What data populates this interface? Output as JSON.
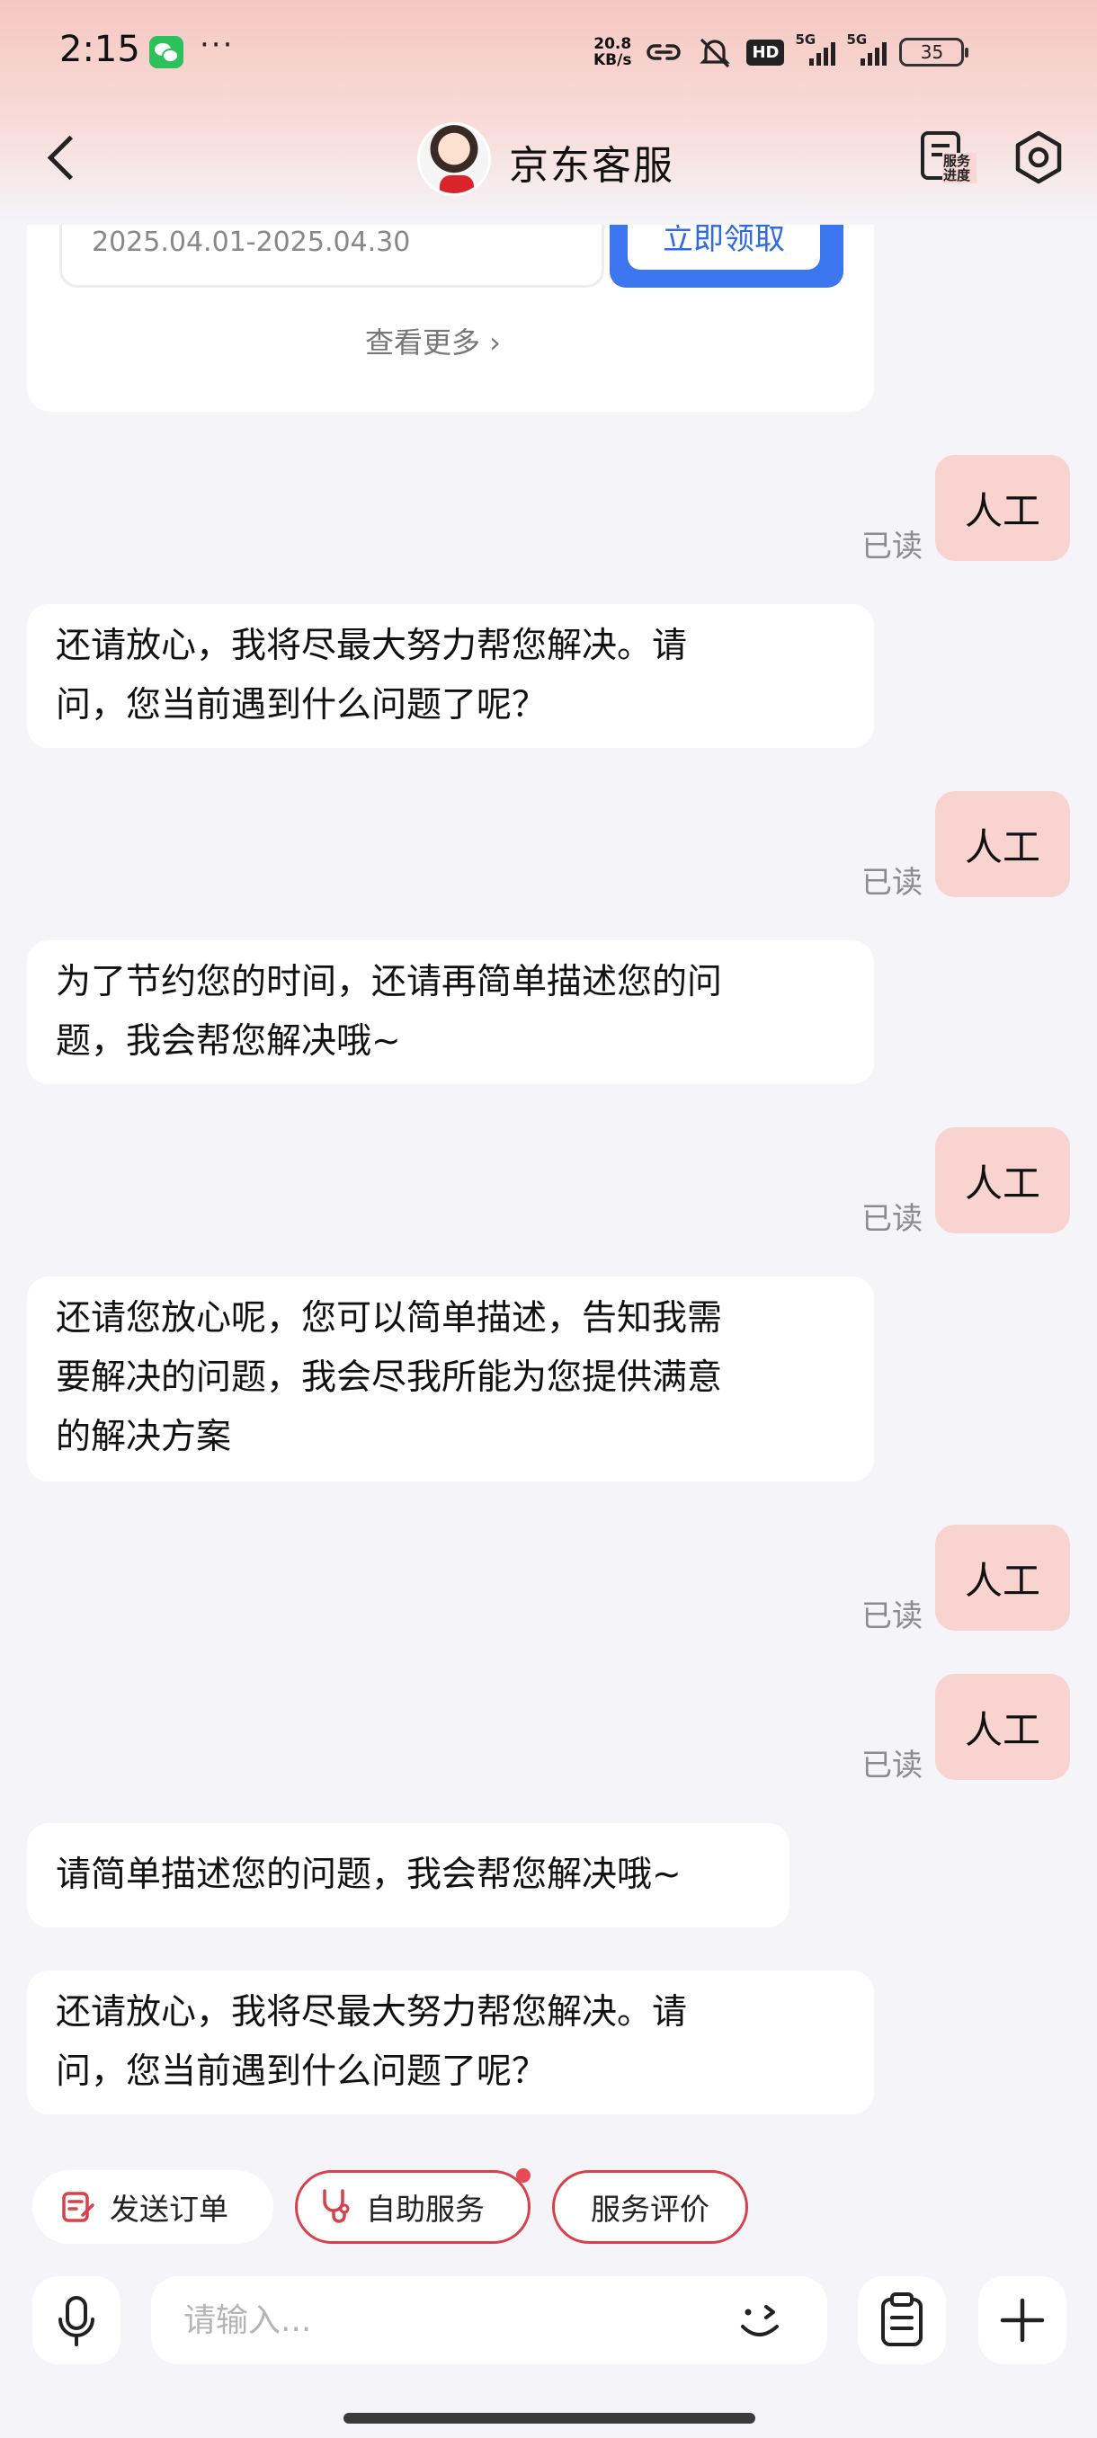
{
  "status_bar": {
    "time": "2:15",
    "net_speed_value": "20.8",
    "net_speed_unit": "KB/s",
    "hd_label": "HD",
    "signal1_label": "5G",
    "signal2_label": "5G",
    "battery": "35"
  },
  "header": {
    "title": "京东客服",
    "service_progress_label": "服务进度"
  },
  "coupon_card": {
    "validity": "2025.04.01-2025.04.30",
    "claim_label": "立即领取",
    "see_more_label": "查看更多 ›"
  },
  "read_label": "已读",
  "messages": [
    {
      "role": "user",
      "text": "人工"
    },
    {
      "role": "bot",
      "lines": [
        "还请放心，我将尽最大努力帮您解决。请",
        "问，您当前遇到什么问题了呢？"
      ]
    },
    {
      "role": "user",
      "text": "人工"
    },
    {
      "role": "bot",
      "lines": [
        "为了节约您的时间，还请再简单描述您的问",
        "题，我会帮您解决哦~"
      ]
    },
    {
      "role": "user",
      "text": "人工"
    },
    {
      "role": "bot",
      "lines": [
        "还请您放心呢，您可以简单描述，告知我需",
        "要解决的问题，我会尽我所能为您提供满意",
        "的解决方案"
      ]
    },
    {
      "role": "user",
      "text": "人工"
    },
    {
      "role": "user",
      "text": "人工"
    },
    {
      "role": "bot",
      "lines": [
        "请简单描述您的问题，我会帮您解决哦~"
      ]
    },
    {
      "role": "bot",
      "lines": [
        "还请放心，我将尽最大努力帮您解决。请",
        "问，您当前遇到什么问题了呢？"
      ]
    }
  ],
  "quick_actions": {
    "send_order": "发送订单",
    "self_service": "自助服务",
    "service_rating": "服务评价"
  },
  "input_bar": {
    "placeholder": "请输入..."
  },
  "colors": {
    "accent_red": "#d8404a",
    "user_bubble": "#f8d3cf",
    "link_blue": "#2f6ae0"
  }
}
